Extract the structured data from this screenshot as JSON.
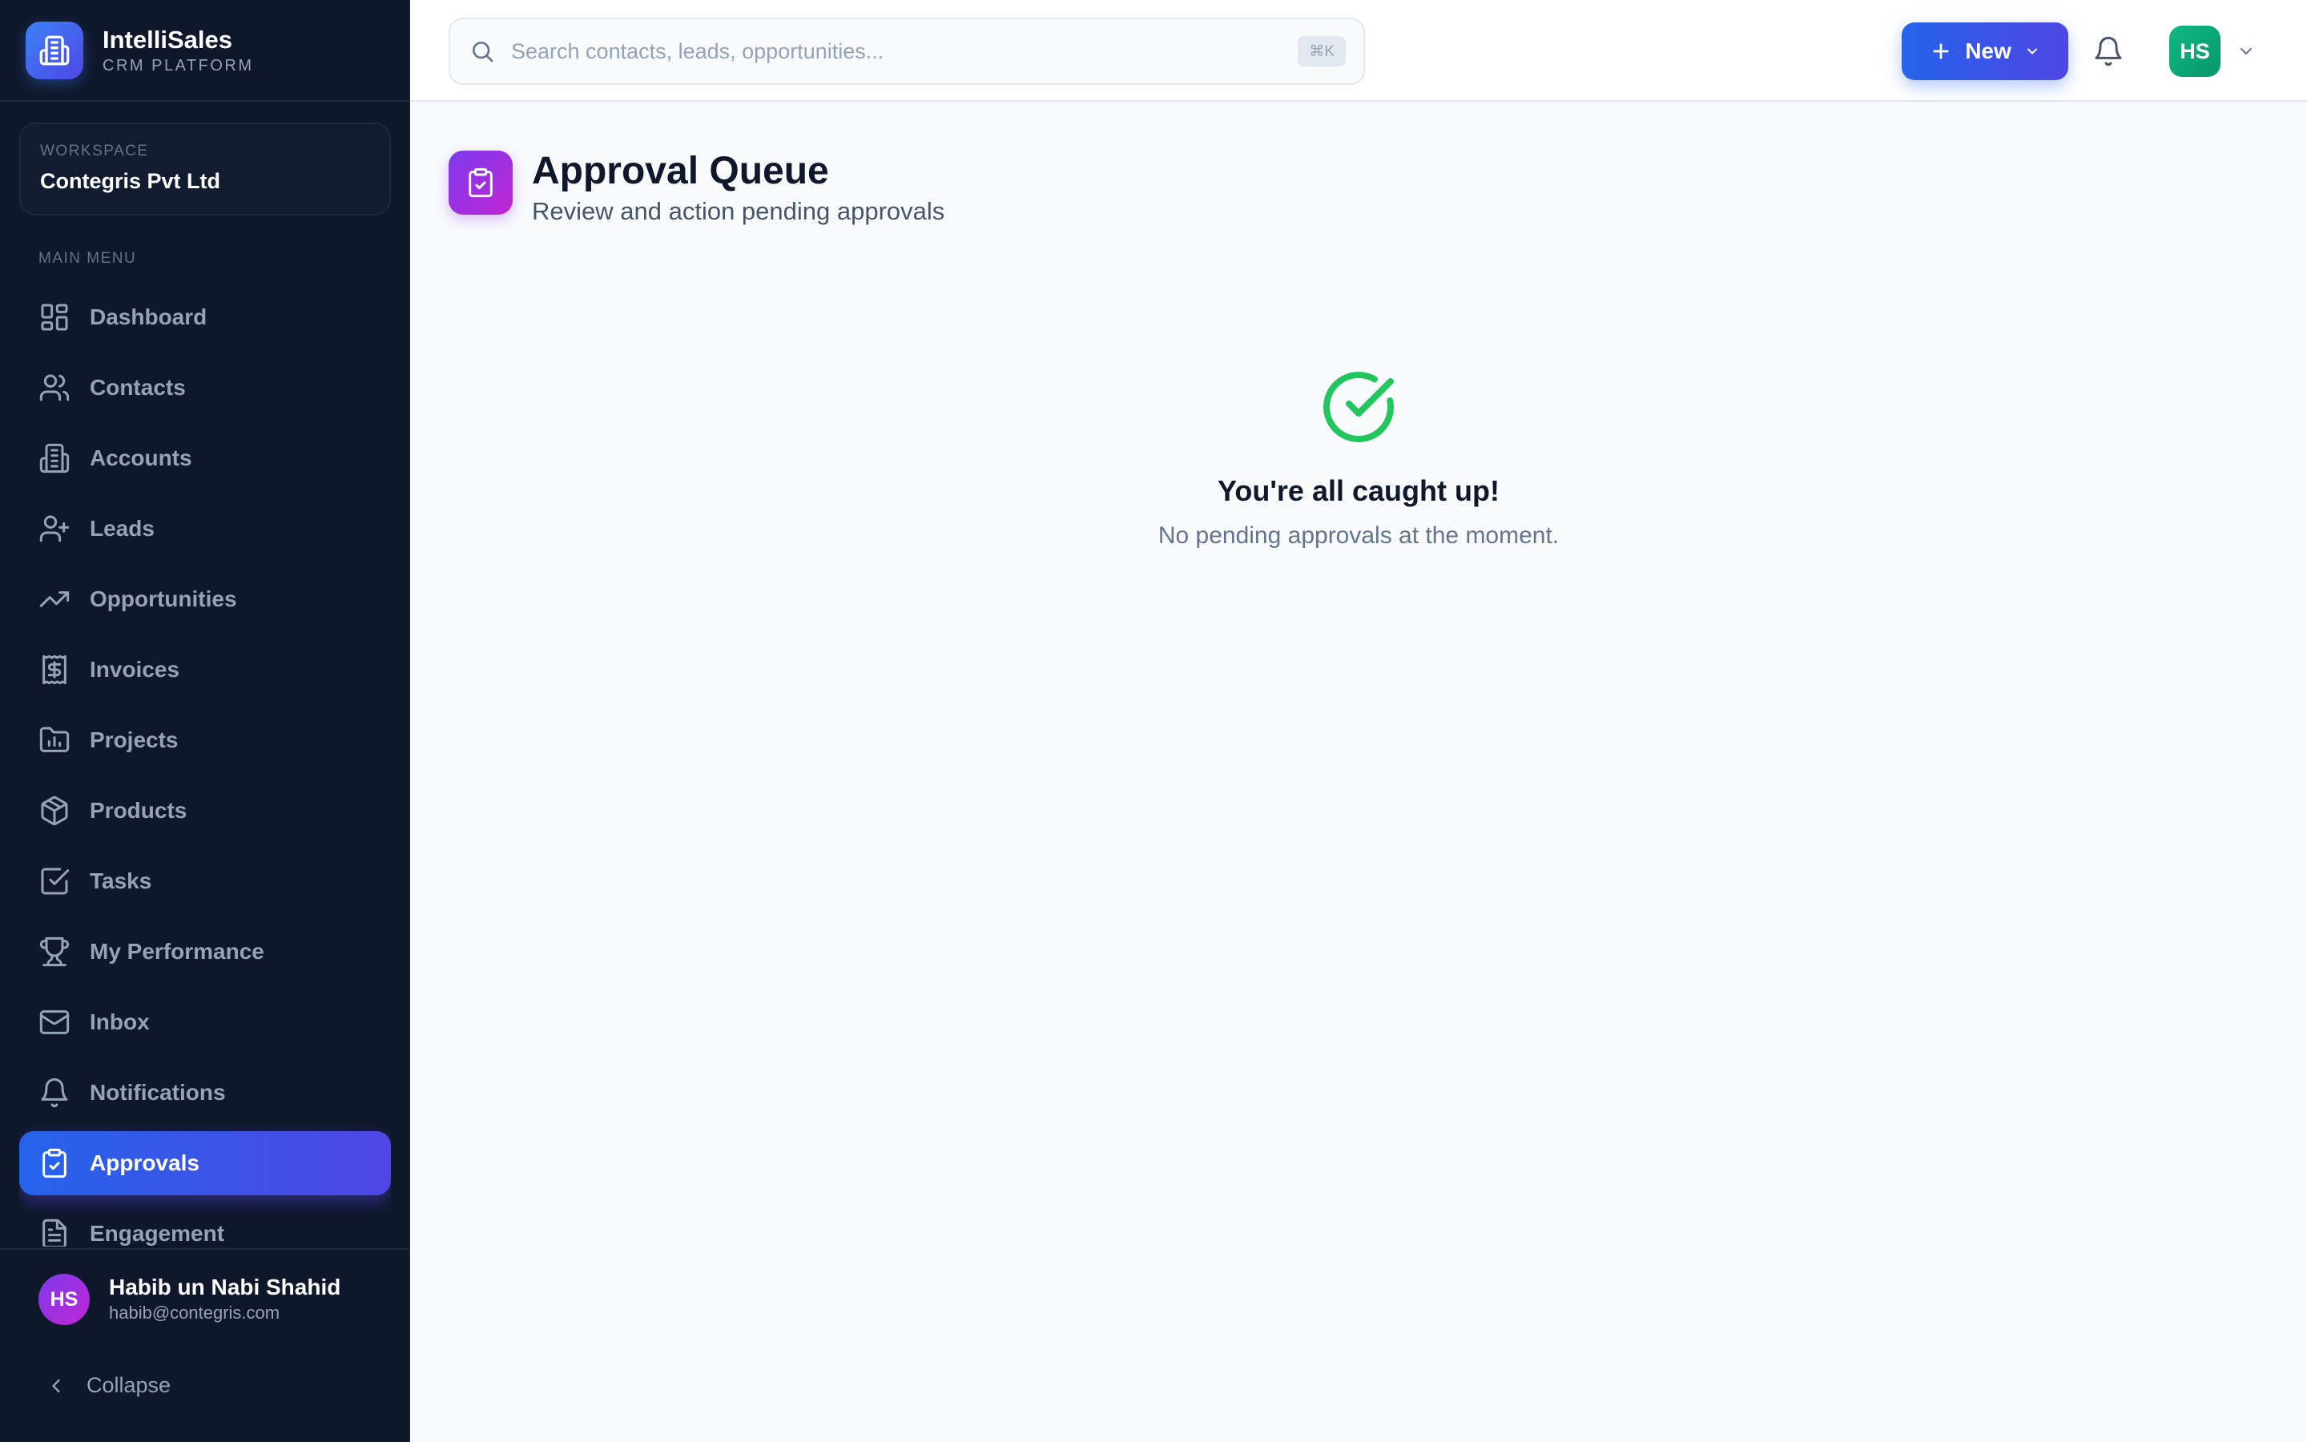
{
  "brand": {
    "name": "IntelliSales",
    "subtitle": "CRM PLATFORM"
  },
  "workspace": {
    "label": "WORKSPACE",
    "name": "Contegris Pvt Ltd"
  },
  "sidebar": {
    "menu_label": "MAIN MENU",
    "items": [
      {
        "label": "Dashboard",
        "icon": "dashboard-icon"
      },
      {
        "label": "Contacts",
        "icon": "users-icon"
      },
      {
        "label": "Accounts",
        "icon": "building-icon"
      },
      {
        "label": "Leads",
        "icon": "user-plus-icon"
      },
      {
        "label": "Opportunities",
        "icon": "trending-up-icon"
      },
      {
        "label": "Invoices",
        "icon": "receipt-icon"
      },
      {
        "label": "Projects",
        "icon": "folder-chart-icon"
      },
      {
        "label": "Products",
        "icon": "package-icon"
      },
      {
        "label": "Tasks",
        "icon": "check-square-icon"
      },
      {
        "label": "My Performance",
        "icon": "trophy-icon"
      },
      {
        "label": "Inbox",
        "icon": "mail-icon"
      },
      {
        "label": "Notifications",
        "icon": "bell-icon"
      },
      {
        "label": "Approvals",
        "icon": "clipboard-check-icon",
        "active": true
      },
      {
        "label": "Engagement",
        "icon": "file-text-icon"
      }
    ]
  },
  "user": {
    "initials": "HS",
    "name": "Habib un Nabi Shahid",
    "email": "habib@contegris.com"
  },
  "collapse_label": "Collapse",
  "search": {
    "placeholder": "Search contacts, leads, opportunities...",
    "shortcut": "⌘K"
  },
  "topbar": {
    "new_label": "New",
    "avatar_initials": "HS"
  },
  "page": {
    "title": "Approval Queue",
    "subtitle": "Review and action pending approvals"
  },
  "empty_state": {
    "title": "You're all caught up!",
    "message": "No pending approvals at the moment."
  },
  "colors": {
    "sidebar_bg": "#0f172a",
    "accent": "#2563eb",
    "accent_end": "#4f46e5",
    "success": "#22c55e",
    "page_icon": "#9333ea",
    "avatar_green": "#10b981"
  }
}
